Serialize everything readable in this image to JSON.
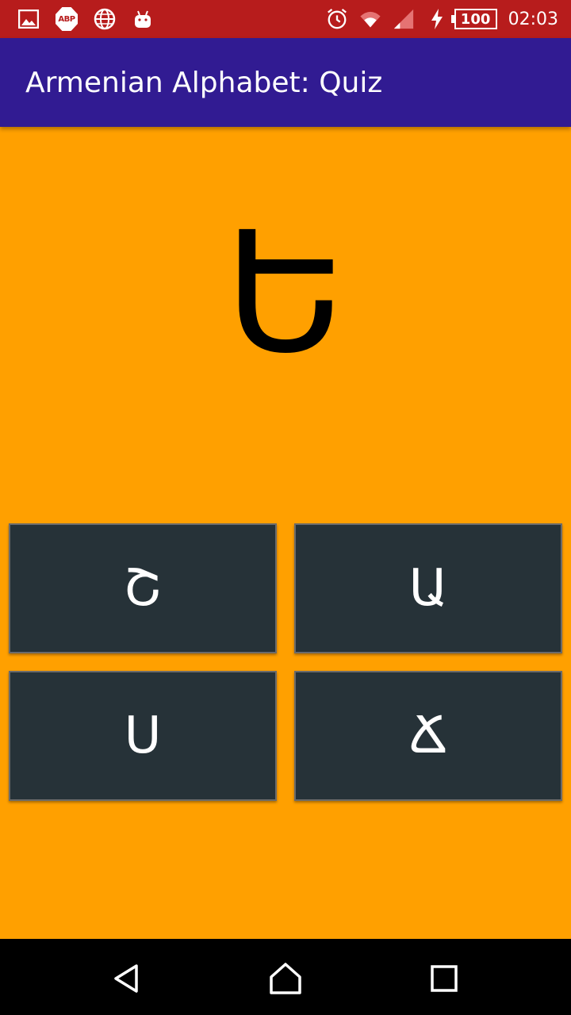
{
  "status_bar": {
    "background": "#B71C1C",
    "left_icons": [
      "image-icon",
      "adblock-icon",
      "globe-icon",
      "android-icon"
    ],
    "adblock_label": "ABP",
    "right_icons": [
      "alarm-icon",
      "wifi-icon",
      "signal-icon",
      "charging-icon"
    ],
    "battery_level": "100",
    "time": "02:03"
  },
  "app_bar": {
    "background": "#311B92",
    "title": "Armenian Alphabet: Quiz"
  },
  "quiz": {
    "background": "#FFA000",
    "question_letter": "Ե",
    "answers": [
      {
        "label": "Շ"
      },
      {
        "label": "Ա"
      },
      {
        "label": "Ս"
      },
      {
        "label": "Ճ"
      }
    ],
    "answer_color": "#263238"
  },
  "nav_bar": {
    "buttons": [
      "back-icon",
      "home-icon",
      "recent-apps-icon"
    ]
  }
}
